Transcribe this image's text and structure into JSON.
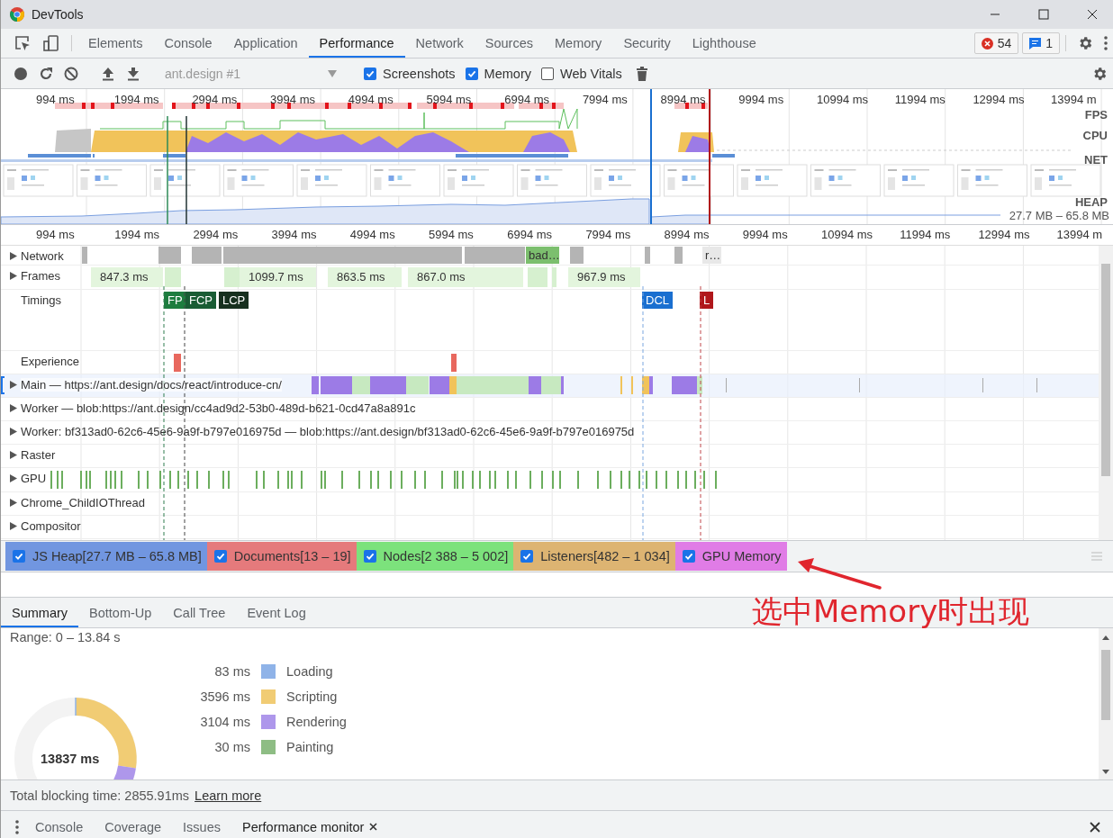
{
  "window": {
    "title": "DevTools"
  },
  "panel_tabs": [
    {
      "label": "Elements",
      "selected": false
    },
    {
      "label": "Console",
      "selected": false
    },
    {
      "label": "Application",
      "selected": false
    },
    {
      "label": "Performance",
      "selected": true
    },
    {
      "label": "Network",
      "selected": false
    },
    {
      "label": "Sources",
      "selected": false
    },
    {
      "label": "Memory",
      "selected": false
    },
    {
      "label": "Security",
      "selected": false
    },
    {
      "label": "Lighthouse",
      "selected": false
    }
  ],
  "badges": {
    "errors": "54",
    "messages": "1"
  },
  "toolbar": {
    "recording": "ant.design #1",
    "options": [
      {
        "label": "Screenshots",
        "checked": true
      },
      {
        "label": "Memory",
        "checked": true
      },
      {
        "label": "Web Vitals",
        "checked": false
      }
    ]
  },
  "overview": {
    "ticks": [
      "994 ms",
      "1994 ms",
      "2994 ms",
      "3994 ms",
      "4994 ms",
      "5994 ms",
      "6994 ms",
      "7994 ms",
      "8994 ms",
      "9994 ms",
      "10994 ms",
      "11994 ms",
      "12994 ms",
      "13994 m"
    ],
    "lanes": [
      "FPS",
      "CPU",
      "NET",
      "HEAP"
    ],
    "heap_range": "27.7 MB – 65.8 MB"
  },
  "ruler": [
    "994 ms",
    "1994 ms",
    "2994 ms",
    "3994 ms",
    "4994 ms",
    "5994 ms",
    "6994 ms",
    "7994 ms",
    "8994 ms",
    "9994 ms",
    "10994 ms",
    "11994 ms",
    "12994 ms",
    "13994 m"
  ],
  "tracks": [
    {
      "kind": "network",
      "label": "Network",
      "expanded": false,
      "items": [
        "bad…",
        "r…"
      ]
    },
    {
      "kind": "frames",
      "label": "Frames",
      "expanded": false,
      "items": [
        "847.3 ms",
        "1099.7 ms",
        "863.5 ms",
        "867.0 ms",
        "967.9 ms"
      ]
    },
    {
      "kind": "timings",
      "label": "Timings",
      "markers": [
        {
          "label": "FP",
          "color": "#1e7d3f"
        },
        {
          "label": "FCP",
          "color": "#195c34"
        },
        {
          "label": "LCP",
          "color": "#17301f"
        },
        {
          "label": "DCL",
          "color": "#1a6fd0"
        },
        {
          "label": "L",
          "color": "#b0171b"
        }
      ]
    },
    {
      "kind": "experience",
      "label": "Experience"
    },
    {
      "kind": "main",
      "label": "Main — https://ant.design/docs/react/introduce-cn/",
      "expanded": false,
      "selected": true
    },
    {
      "kind": "thread",
      "label": "Worker — blob:https://ant.design/cc4ad9d2-53b0-489d-b621-0cd47a8a891c",
      "expanded": false,
      "selected": false
    },
    {
      "kind": "thread",
      "label": "Worker: bf313ad0-62c6-45e6-9a9f-b797e016975d — blob:https://ant.design/bf313ad0-62c6-45e6-9a9f-b797e016975d",
      "expanded": false,
      "selected": false
    },
    {
      "kind": "thread",
      "label": "Raster",
      "expanded": false,
      "selected": false
    },
    {
      "kind": "gpu",
      "label": "GPU",
      "expanded": false,
      "selected": false
    },
    {
      "kind": "thread",
      "label": "Chrome_ChildIOThread",
      "expanded": false,
      "selected": false
    },
    {
      "kind": "thread",
      "label": "Compositor",
      "expanded": false,
      "selected": false
    }
  ],
  "counters": [
    {
      "label": "JS Heap[27.7 MB – 65.8 MB]",
      "checked": true,
      "color": "#7196e0"
    },
    {
      "label": "Documents[13 – 19]",
      "checked": true,
      "color": "#e57a7c"
    },
    {
      "label": "Nodes[2 388 – 5 002]",
      "checked": true,
      "color": "#7ce27c"
    },
    {
      "label": "Listeners[482 – 1 034]",
      "checked": true,
      "color": "#ddb472"
    },
    {
      "label": "GPU Memory",
      "checked": true,
      "color": "#e07ce6"
    }
  ],
  "annotation": "选中Memory时出现",
  "details_tabs": [
    {
      "label": "Summary",
      "selected": true
    },
    {
      "label": "Bottom-Up",
      "selected": false
    },
    {
      "label": "Call Tree",
      "selected": false
    },
    {
      "label": "Event Log",
      "selected": false
    }
  ],
  "summary": {
    "range": "Range: 0 – 13.84 s",
    "total": "13837 ms",
    "legend": [
      {
        "value": "83 ms",
        "label": "Loading",
        "color": "#8fb3e8"
      },
      {
        "value": "3596 ms",
        "label": "Scripting",
        "color": "#f1cc74"
      },
      {
        "value": "3104 ms",
        "label": "Rendering",
        "color": "#ae97eb"
      },
      {
        "value": "30 ms",
        "label": "Painting",
        "color": "#8ebd84"
      }
    ]
  },
  "footer": {
    "text": "Total blocking time: 2855.91ms",
    "link": "Learn more"
  },
  "drawer_tabs": [
    {
      "label": "Console",
      "selected": false,
      "closable": false
    },
    {
      "label": "Coverage",
      "selected": false,
      "closable": false
    },
    {
      "label": "Issues",
      "selected": false,
      "closable": false
    },
    {
      "label": "Performance monitor",
      "selected": true,
      "closable": true
    }
  ]
}
